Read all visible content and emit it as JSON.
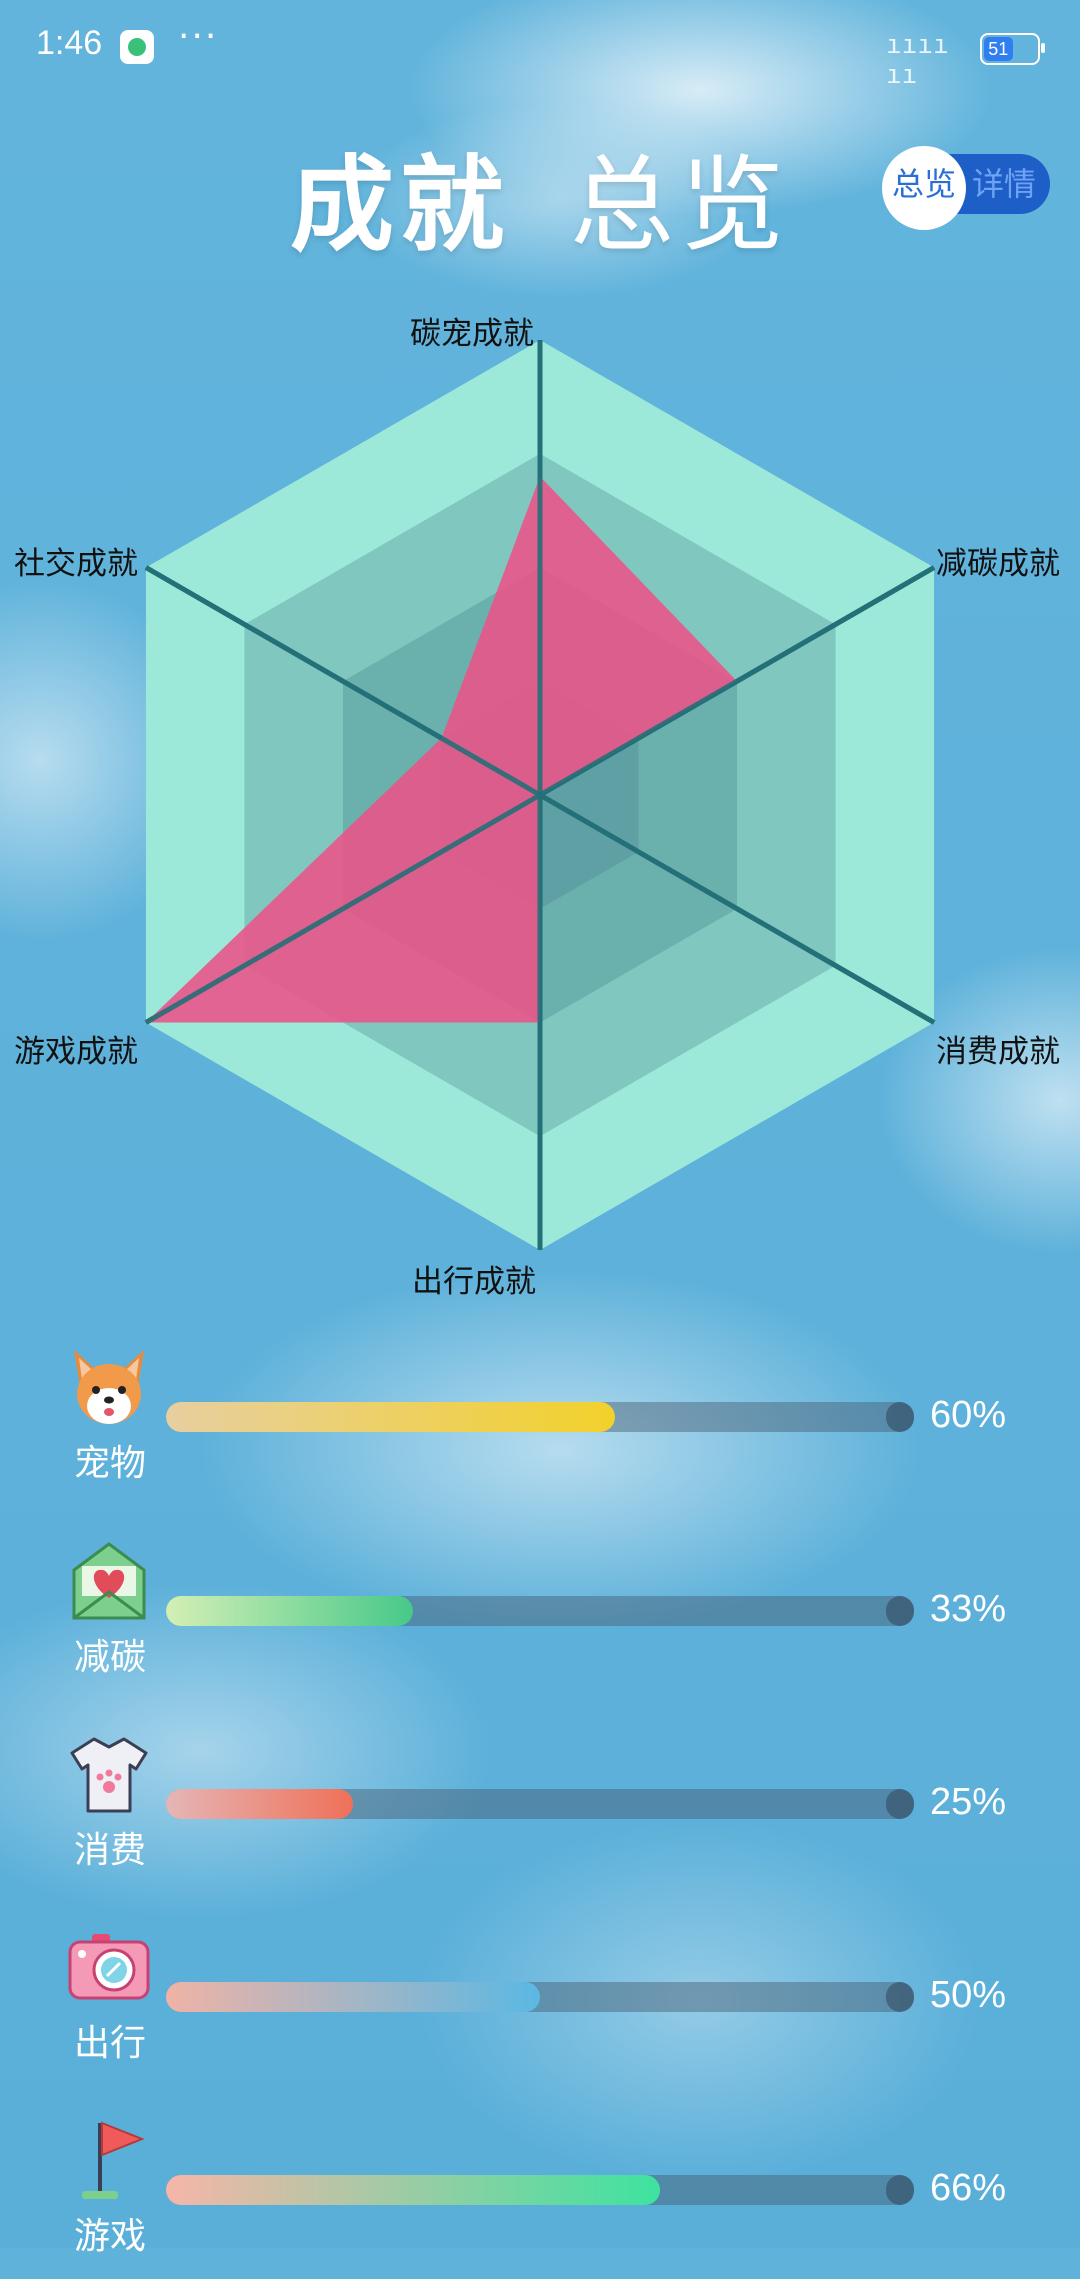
{
  "status_bar": {
    "time": "1:46",
    "more": "···",
    "signal": "ıııı ıı",
    "battery": "51"
  },
  "header": {
    "title_part1": "成就",
    "title_part2": "总览",
    "toggle_active": "总览",
    "toggle_inactive": "详情"
  },
  "chart_data": {
    "type": "radar",
    "axes": [
      "碳宠成就",
      "减碳成就",
      "消费成就",
      "出行成就",
      "游戏成就",
      "社交成就"
    ],
    "values": [
      0.7,
      0.5,
      0.0,
      0.5,
      1.0,
      0.25
    ],
    "max": 1,
    "rings": 4,
    "colors": {
      "ring_outer": "#9ce9d9",
      "ring_mid": "#7fc7bf",
      "ring_inner": "#6ab0ad",
      "ring_center": "#5fa0a4",
      "axis": "#247078",
      "polygon": "#e9558a"
    }
  },
  "progress": [
    {
      "label": "宠物",
      "value": 0.6,
      "percent_text": "60%",
      "icon": "corgi-icon",
      "gradient": [
        "#e7cfa0",
        "#f2d12c"
      ]
    },
    {
      "label": "减碳",
      "value": 0.33,
      "percent_text": "33%",
      "icon": "heart-envelope-icon",
      "gradient": [
        "#d4efb5",
        "#47c989"
      ]
    },
    {
      "label": "消费",
      "value": 0.25,
      "percent_text": "25%",
      "icon": "tshirt-icon",
      "gradient": [
        "#e5b6b6",
        "#ef7058"
      ]
    },
    {
      "label": "出行",
      "value": 0.5,
      "percent_text": "50%",
      "icon": "camera-icon",
      "gradient": [
        "#f0b3a6",
        "#5ab8e3"
      ]
    },
    {
      "label": "游戏",
      "value": 0.66,
      "percent_text": "66%",
      "icon": "flag-icon",
      "gradient": [
        "#f6b6a8",
        "#3de3a0"
      ]
    }
  ]
}
